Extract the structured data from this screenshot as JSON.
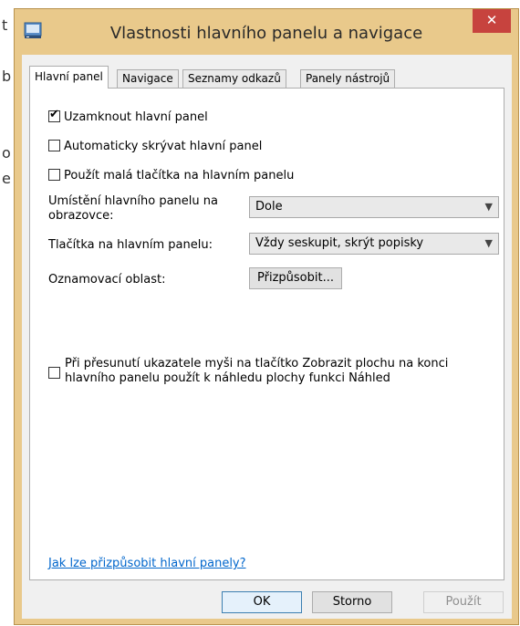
{
  "background_fragments": [
    "t",
    "b",
    "o",
    "e"
  ],
  "window": {
    "title": "Vlastnosti hlavního panelu a navigace",
    "close_glyph": "✕",
    "app_icon": "taskbar-properties-icon"
  },
  "tabs": [
    {
      "label": "Hlavní panel",
      "active": true
    },
    {
      "label": "Navigace",
      "active": false
    },
    {
      "label": "Seznamy odkazů",
      "active": false
    },
    {
      "label": "Panely nástrojů",
      "active": false
    }
  ],
  "options": {
    "lock_taskbar": {
      "label": "Uzamknout hlavní panel",
      "checked": true
    },
    "auto_hide": {
      "label": "Automaticky skrývat hlavní panel",
      "checked": false
    },
    "small_buttons": {
      "label": "Použít malá tlačítka na hlavním panelu",
      "checked": false
    }
  },
  "taskbar_location": {
    "label": "Umístění hlavního panelu na obrazovce:",
    "value": "Dole"
  },
  "taskbar_buttons": {
    "label": "Tlačítka na hlavním panelu:",
    "value": "Vždy seskupit, skrýt popisky"
  },
  "notification_area": {
    "label": "Oznamovací oblast:",
    "button": "Přizpůsobit..."
  },
  "peek": {
    "label": "Při přesunutí ukazatele myši na tlačítko Zobrazit plochu na konci hlavního panelu použít k náhledu plochy funkci Náhled",
    "checked": false
  },
  "help_link": "Jak lze přizpůsobit hlavní panely?",
  "footer": {
    "ok": "OK",
    "cancel": "Storno",
    "apply": "Použít"
  },
  "colors": {
    "title_bar": "#e9c98b",
    "close_button": "#c7433e",
    "link": "#0066cc"
  }
}
